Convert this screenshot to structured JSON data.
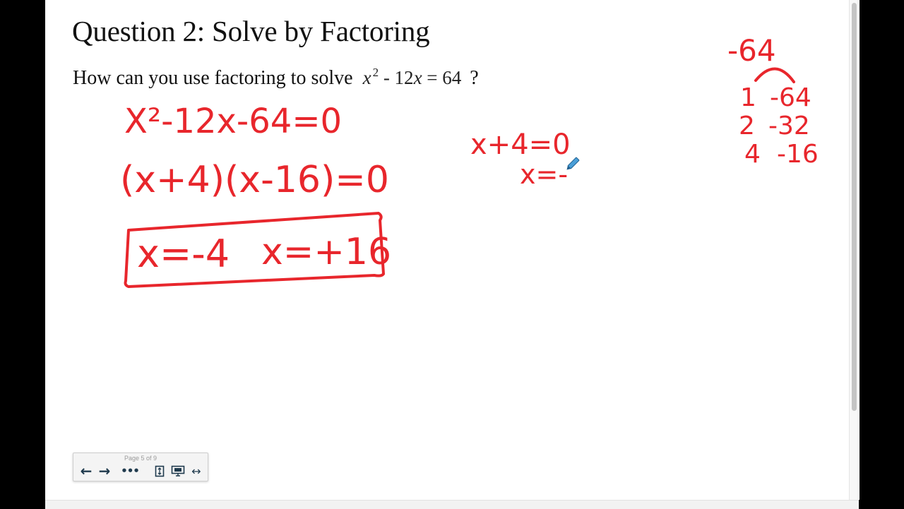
{
  "document": {
    "title": "Question 2: Solve by Factoring",
    "question": {
      "text": "How can  you use factoring to solve",
      "eq_x": "x",
      "eq_exp": "2",
      "eq_rest": " - 12",
      "eq_x2": "x",
      "eq_end": " = 64",
      "qmark": "?"
    }
  },
  "annotations": {
    "ink_color": "#e8262c",
    "standard_form": "X²-12x-64=0",
    "factored": "(x+4)(x-16)=0",
    "solution_1": "x=-4",
    "solution_2": "x=+16",
    "step_line_1": "x+4=0",
    "step_line_2": "x=-",
    "factor_target": "-64",
    "factor_pairs": [
      {
        "a": "1",
        "b": "-64"
      },
      {
        "a": "2",
        "b": "-32"
      },
      {
        "a": "4",
        "b": "-16"
      }
    ]
  },
  "toolbar": {
    "page_indicator": "Page 5 of 9",
    "prev_icon": "←",
    "next_icon": "→",
    "more_icon": "•••",
    "fit_width_icon": "↔"
  },
  "icons": {
    "prev": "arrow-left-icon",
    "next": "arrow-right-icon",
    "more": "more-dots-icon",
    "fit_height": "fit-height-icon",
    "fit_page": "fit-page-icon",
    "fit_width": "fit-width-icon",
    "pen": "pen-cursor-icon"
  }
}
